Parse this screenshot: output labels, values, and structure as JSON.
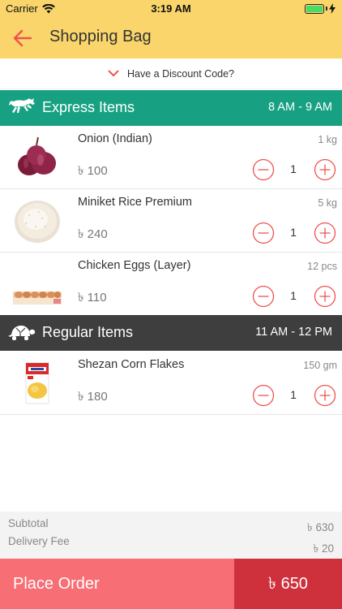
{
  "status_bar": {
    "carrier": "Carrier",
    "time": "3:19 AM",
    "battery_level": 1.0
  },
  "nav": {
    "title": "Shopping Bag"
  },
  "discount": {
    "label": "Have a Discount Code?"
  },
  "express": {
    "title": "Express Items",
    "time": "8 AM - 9 AM",
    "items": [
      {
        "name": "Onion (Indian)",
        "unit": "1 kg",
        "price": "৳ 100",
        "qty": "1"
      },
      {
        "name": "Miniket Rice Premium",
        "unit": "5 kg",
        "price": "৳ 240",
        "qty": "1"
      },
      {
        "name": "Chicken Eggs (Layer)",
        "unit": "12 pcs",
        "price": "৳ 110",
        "qty": "1"
      }
    ]
  },
  "regular": {
    "title": "Regular Items",
    "time": "11 AM - 12 PM",
    "items": [
      {
        "name": "Shezan Corn Flakes",
        "unit": "150 gm",
        "price": "৳ 180",
        "qty": "1"
      }
    ]
  },
  "totals": {
    "subtotal_label": "Subtotal",
    "subtotal_value": "৳ 630",
    "delivery_label": "Delivery Fee",
    "delivery_value": "৳ 20"
  },
  "footer": {
    "place_order_label": "Place Order",
    "total": "৳ 650"
  },
  "colors": {
    "nav_bg": "#f9d56b",
    "accent": "#ef5350",
    "express_bg": "#17a182",
    "regular_bg": "#3e3e3e",
    "place_order_bg": "#f76e75",
    "total_bg": "#cf313c"
  }
}
